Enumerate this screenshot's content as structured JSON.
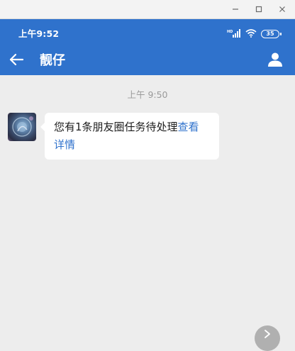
{
  "window": {
    "controls": [
      "minimize-icon",
      "maximize-icon",
      "close-icon"
    ]
  },
  "status_bar": {
    "time": "上午9:52",
    "network": "HD",
    "battery": "35"
  },
  "header": {
    "title": "靓仔",
    "accent_color": "#2f72cc"
  },
  "chat": {
    "timestamp": "上午 9:50",
    "message": {
      "text": "您有1条朋友圈任务待处理",
      "link_text": "查看详情"
    }
  }
}
